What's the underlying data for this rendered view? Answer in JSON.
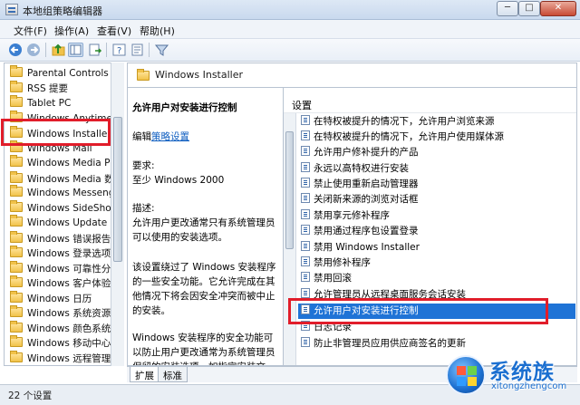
{
  "window": {
    "title": "本地组策略编辑器",
    "controls": [
      "─",
      "□",
      "✕"
    ]
  },
  "menu": [
    "文件(F)",
    "操作(A)",
    "查看(V)",
    "帮助(H)"
  ],
  "toolbar_icons": [
    "back-arrow-icon",
    "forward-arrow-icon",
    "up-folder-icon",
    "show-hide-tree-icon",
    "export-list-icon",
    "help-icon",
    "properties-icon",
    "filter-icon"
  ],
  "tree": {
    "items": [
      "Parental Controls",
      "RSS 提要",
      "Tablet PC",
      "Windows Anytime Upgrade",
      "Windows Installer",
      "Windows Mail",
      "Windows Media Player",
      "Windows Media 数字",
      "Windows Messenger",
      "Windows SideShow",
      "Windows Update",
      "Windows 错误报告",
      "Windows 登录选项",
      "Windows 可靠性分析",
      "Windows 客户体验改",
      "Windows 日历",
      "Windows 系统资源管",
      "Windows 颜色系统",
      "Windows 移动中心",
      "Windows 远程管理 ("
    ],
    "selected_index": 4
  },
  "right": {
    "header_title": "Windows Installer",
    "description": {
      "title": "允许用户对安装进行控制",
      "edit_prefix": "编辑",
      "edit_link": "策略设置",
      "req_label": "要求:",
      "req_value": "至少 Windows 2000",
      "desc_label": "描述:",
      "desc_text": "允许用户更改通常只有系统管理员可以使用的安装选项。",
      "para1": "该设置绕过了 Windows 安装程序的一些安全功能。它允许完成在其他情况下将会因安全冲突而被中止的安装。",
      "para2": "Windows 安装程序的安全功能可以防止用户更改通常为系统管理员保留的安装选项，如指定安装文"
    },
    "list_header": "设置",
    "settings": [
      "在特权被提升的情况下，允许用户浏览来源",
      "在特权被提升的情况下，允许用户使用媒体源",
      "允许用户修补提升的产品",
      "永远以高特权进行安装",
      "禁止使用重新启动管理器",
      "关闭新来源的浏览对话框",
      "禁用享元修补程序",
      "禁用通过程序包设置登录",
      "禁用 Windows Installer",
      "禁用修补程序",
      "禁用回滚",
      "允许管理员从远程桌面服务会话安装",
      "允许用户对安装进行控制",
      "日志记录",
      "防止非管理员应用供应商签名的更新"
    ],
    "selected_setting_index": 12,
    "tabs": [
      "扩展",
      "标准"
    ]
  },
  "status": {
    "text": "22 个设置"
  },
  "watermark": {
    "name": "系统族",
    "url": "xitongzhengcom"
  }
}
